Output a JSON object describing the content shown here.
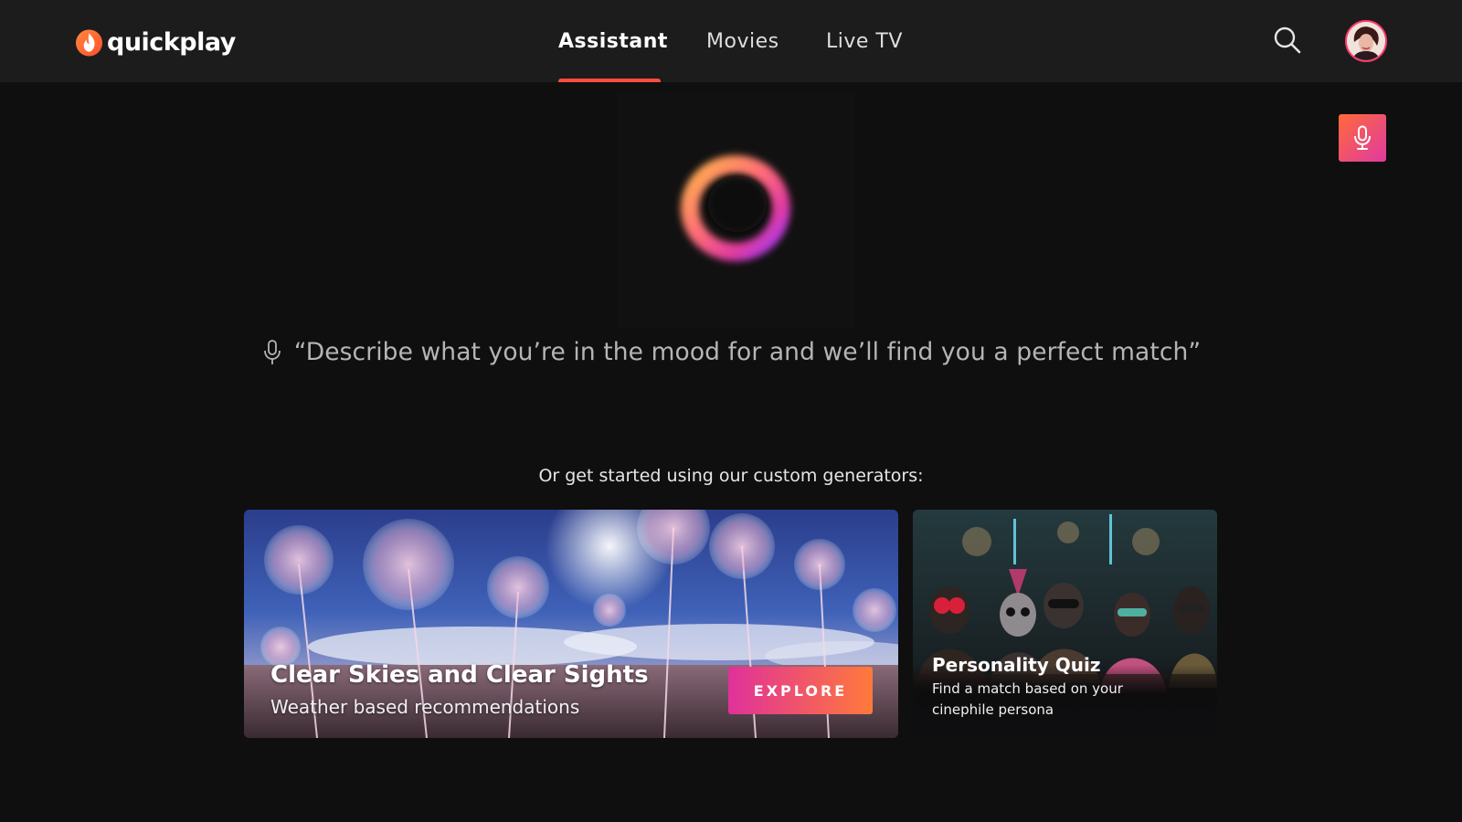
{
  "header": {
    "logo_text": "quickplay",
    "nav": [
      {
        "label": "Assistant",
        "active": true
      },
      {
        "label": "Movies",
        "active": false
      },
      {
        "label": "Live TV",
        "active": false
      }
    ],
    "search_icon": "search-icon",
    "avatar_icon": "user-avatar"
  },
  "assistant": {
    "mic_button_icon": "microphone-icon",
    "orb_icon": "voice-assistant-orb",
    "prompt_text": "“Describe what you’re in the mood for and we’ll find you a perfect match”",
    "generators_label": "Or get started using our custom generators:"
  },
  "cards": [
    {
      "title": "Clear Skies and Clear Sights",
      "subtitle": "Weather based recommendations",
      "button_label": "EXPLORE"
    },
    {
      "title": "Personality Quiz",
      "subtitle": "Find a match based on your cinephile persona"
    }
  ],
  "colors": {
    "accent": "#ff4d3d",
    "gradient_start": "#ff6a3a",
    "gradient_end": "#e03aa0",
    "background": "#0f0f0f",
    "header_bg": "#1c1c1c"
  }
}
